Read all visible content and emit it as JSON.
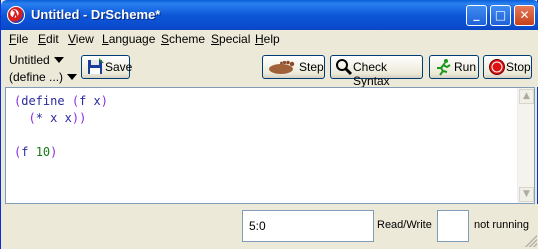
{
  "window": {
    "title": "Untitled - DrScheme*",
    "icon": "drscheme-lambda-icon",
    "lambda_glyph": "λ",
    "controls": {
      "minimize": "_",
      "maximize": "□",
      "close": "✕"
    }
  },
  "menubar": {
    "items": [
      "File",
      "Edit",
      "View",
      "Language",
      "Scheme",
      "Special",
      "Help"
    ]
  },
  "toolbar": {
    "file_dropdown": "Untitled",
    "define_dropdown": "(define ...)",
    "save_label": "Save",
    "step_label": "Step",
    "check_syntax_label": "Check Syntax",
    "run_label": "Run",
    "stop_label": "Stop",
    "icons": {
      "save": "floppy-disk-icon",
      "step": "footprint-icon",
      "check_syntax": "magnifier-icon",
      "run": "running-man-icon",
      "stop": "stop-sign-icon"
    }
  },
  "editor": {
    "lines": [
      {
        "tokens": [
          [
            "(",
            "paren"
          ],
          [
            "define",
            "kw"
          ],
          [
            " ",
            "sp"
          ],
          [
            "(",
            "paren"
          ],
          [
            "f",
            "id"
          ],
          [
            " ",
            "sp"
          ],
          [
            "x",
            "id"
          ],
          [
            ")",
            "paren"
          ]
        ]
      },
      {
        "tokens": [
          [
            "  ",
            "sp"
          ],
          [
            "(",
            "paren"
          ],
          [
            "*",
            "id"
          ],
          [
            " ",
            "sp"
          ],
          [
            "x",
            "id"
          ],
          [
            " ",
            "sp"
          ],
          [
            "x",
            "id"
          ],
          [
            ")",
            "paren"
          ],
          [
            ")",
            "paren"
          ]
        ]
      },
      {
        "tokens": []
      },
      {
        "tokens": [
          [
            "(",
            "paren"
          ],
          [
            "f",
            "id"
          ],
          [
            " ",
            "sp"
          ],
          [
            "10",
            "num"
          ],
          [
            ")",
            "paren"
          ]
        ]
      }
    ],
    "colors": {
      "paren": "#8a2be2",
      "keyword": "#2a2aa0",
      "identifier": "#2a2aa0",
      "number": "#1a7a1a"
    }
  },
  "statusbar": {
    "position": "5:0",
    "mode": "Read/Write",
    "run_status": "not running"
  },
  "colors": {
    "titlebar_blue": "#0a5fd8",
    "window_bg": "#ece9d8",
    "close_red": "#c4421a"
  }
}
